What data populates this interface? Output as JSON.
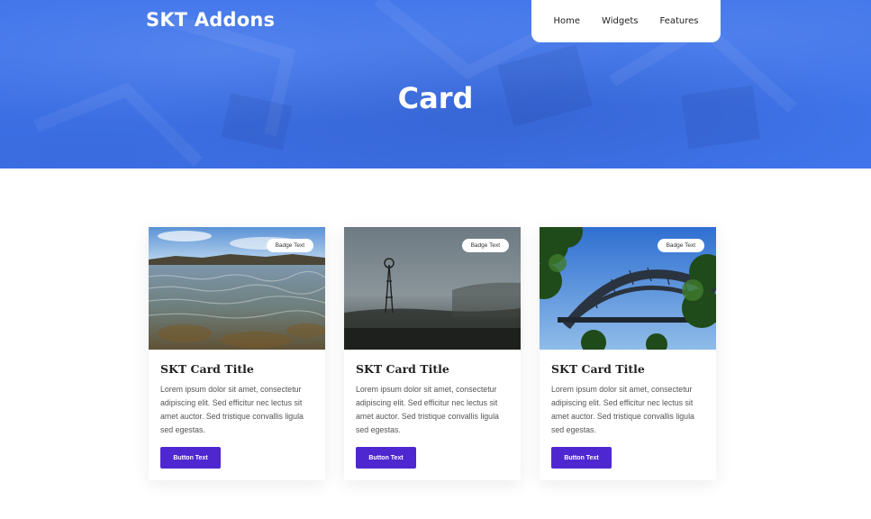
{
  "site": {
    "logo": "SKT Addons",
    "nav": [
      "Home",
      "Widgets",
      "Features"
    ]
  },
  "hero": {
    "title": "Card"
  },
  "cards": [
    {
      "badge": "Badge Text",
      "title": "SKT Card Title",
      "text": "Lorem ipsum dolor sit amet, consectetur adipiscing elit. Sed efficitur nec lectus sit amet auctor. Sed tristique convallis ligula sed egestas.",
      "button": "Button Text",
      "image": "coastal-water-photo"
    },
    {
      "badge": "Badge Text",
      "title": "SKT Card Title",
      "text": "Lorem ipsum dolor sit amet, consectetur adipiscing elit. Sed efficitur nec lectus sit amet auctor. Sed tristique convallis ligula sed egestas.",
      "button": "Button Text",
      "image": "foggy-windmill-photo"
    },
    {
      "badge": "Badge Text",
      "title": "SKT Card Title",
      "text": "Lorem ipsum dolor sit amet, consectetur adipiscing elit. Sed efficitur nec lectus sit amet auctor. Sed tristique convallis ligula sed egestas.",
      "button": "Button Text",
      "image": "harbour-bridge-photo"
    }
  ],
  "colors": {
    "hero_blue": "#3f74ea",
    "button_purple": "#4f27d0"
  }
}
